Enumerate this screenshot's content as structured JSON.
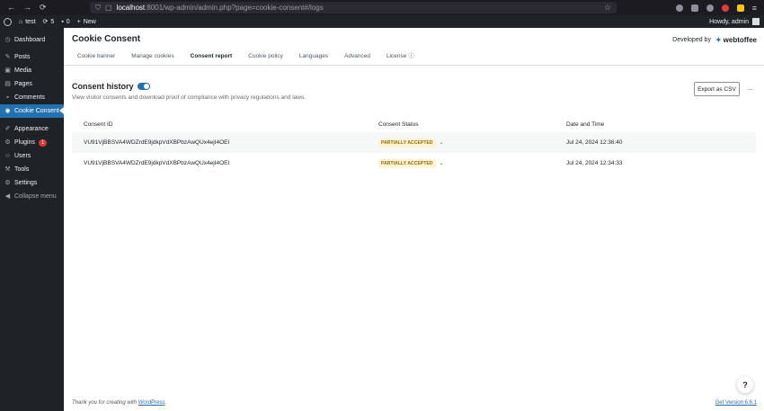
{
  "browser": {
    "url_host": "localhost",
    "url_rest": ":8001/wp-admin/admin.php?page=cookie-consent#/logs",
    "nav": [
      "←",
      "→",
      "⟳"
    ]
  },
  "adminbar": {
    "site": "test",
    "updates": "5",
    "comments": "0",
    "new_label": "New",
    "howdy": "Howdy, admin"
  },
  "sidebar": {
    "items": [
      {
        "label": "Dashboard",
        "icon": "dashboard-icon"
      },
      {
        "label": "Posts",
        "icon": "pin-icon"
      },
      {
        "label": "Media",
        "icon": "media-icon"
      },
      {
        "label": "Pages",
        "icon": "pages-icon"
      },
      {
        "label": "Comments",
        "icon": "comment-icon"
      },
      {
        "label": "Cookie Consent",
        "icon": "cookie-icon"
      },
      {
        "label": "Appearance",
        "icon": "brush-icon"
      },
      {
        "label": "Plugins",
        "icon": "plugin-icon",
        "badge": "1"
      },
      {
        "label": "Users",
        "icon": "users-icon"
      },
      {
        "label": "Tools",
        "icon": "tools-icon"
      },
      {
        "label": "Settings",
        "icon": "settings-icon"
      },
      {
        "label": "Collapse menu",
        "icon": "collapse-icon"
      }
    ]
  },
  "header": {
    "title": "Cookie Consent",
    "developed_by": "Developed by",
    "brand": "webtoffee",
    "tabs": [
      "Cookie banner",
      "Manage cookies",
      "Consent report",
      "Cookie policy",
      "Languages",
      "Advanced",
      "License"
    ]
  },
  "consent": {
    "title": "Consent history",
    "description": "View visitor consents and download proof of compliance with privacy regulations and laws.",
    "export_label": "Export as CSV",
    "more_label": "...",
    "columns": [
      "Consent ID",
      "Consent Status",
      "Date and Time"
    ],
    "rows": [
      {
        "id": "VU91VjBBSVA4WDZrdE9jdkpVdXBPbzAwQUx4ejI4OEI",
        "status": "PARTIALLY ACCEPTED",
        "date": "Jul 24, 2024 12:36:40"
      },
      {
        "id": "VU91VjBBSVA4WDZrdE9jdkpVdXBPbzAwQUx4ejI4OEI",
        "status": "PARTIALLY ACCEPTED",
        "date": "Jul 24, 2024 12:34:33"
      }
    ]
  },
  "footer": {
    "thanks_prefix": "Thank you for creating with ",
    "thanks_link": "WordPress",
    "thanks_suffix": ".",
    "version": "Get Version 6.6.1"
  },
  "help_label": "?",
  "colors": {
    "accent": "#2271b1",
    "sidebar": "#1d2327",
    "status": "#996800"
  }
}
